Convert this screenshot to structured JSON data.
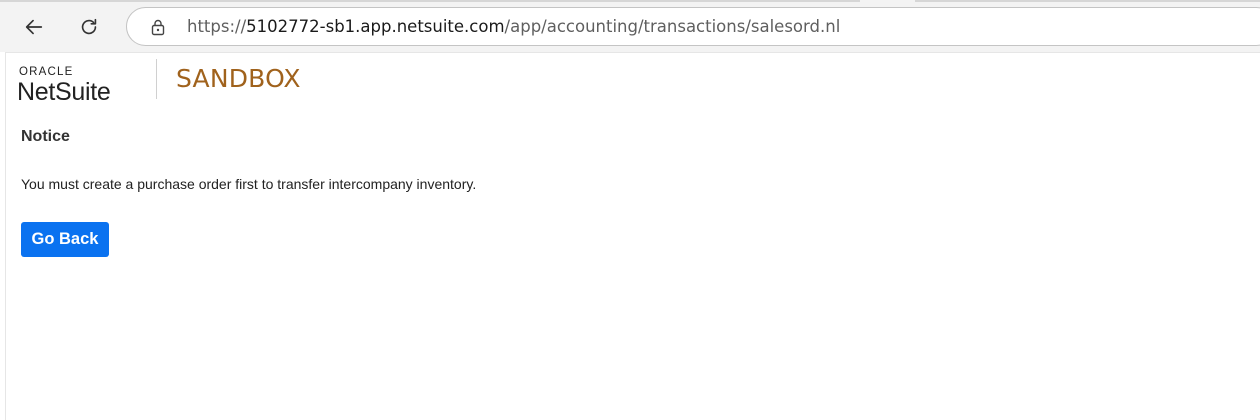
{
  "browser": {
    "url_scheme": "https://",
    "url_host": "5102772-sb1.app.netsuite.com",
    "url_path": "/app/accounting/transactions/salesord.nl"
  },
  "header": {
    "logo_top": "ORACLE",
    "logo_main": "NetSuite",
    "environment": "SANDBOX"
  },
  "notice": {
    "title": "Notice",
    "message": "You must create a purchase order first to transfer intercompany inventory.",
    "button_label": "Go Back"
  },
  "colors": {
    "sandbox_label": "#a0621c",
    "primary_button": "#0a72f0"
  }
}
